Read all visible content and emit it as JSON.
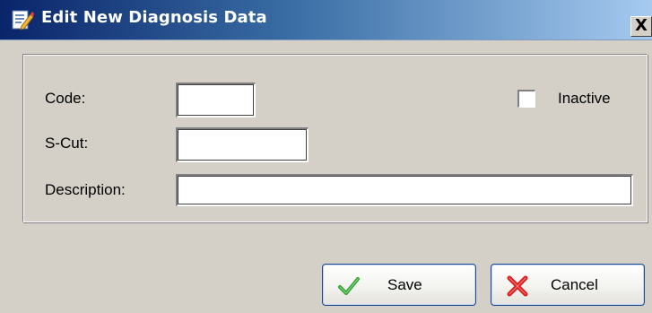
{
  "window": {
    "title": "Edit New Diagnosis Data",
    "close_label": "X"
  },
  "form": {
    "code_label": "Code:",
    "code_value": "",
    "scut_label": "S-Cut:",
    "scut_value": "",
    "description_label": "Description:",
    "description_value": "",
    "inactive_label": "Inactive",
    "inactive_checked": false
  },
  "buttons": {
    "save_label": "Save",
    "save_icon": "checkmark-icon",
    "cancel_label": "Cancel",
    "cancel_icon": "red-x-icon"
  },
  "colors": {
    "titlebar_start": "#0a246a",
    "titlebar_end": "#a6caf0",
    "window_bg": "#d4d0c8",
    "button_border": "#1c4a92",
    "check_green": "#2fa02f",
    "cancel_red": "#d81e1e"
  }
}
